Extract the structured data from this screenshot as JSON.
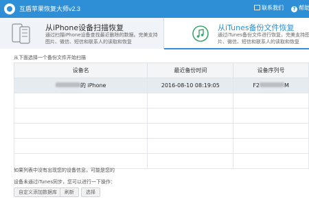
{
  "app": {
    "title": "互盾苹果恢复大师v2.3",
    "contact": "联系我们",
    "help": "帮助"
  },
  "modes": [
    {
      "title": "从iPhone设备扫描恢复",
      "desc": "通过扫描iPhone设备查找最近删除的数据。完美支持图片、微信、短信和联系人的读取和恢复"
    },
    {
      "title": "从iTunes备份文件恢复",
      "desc": "通过iTunes备份文件进行恢复，完美支持图片、微信、短信和联系人的读取和恢复"
    }
  ],
  "hint_top": "从下面选择一个备份文件开始扫描",
  "table": {
    "headers": [
      "设备名",
      "最近备份时间",
      "设备序列号"
    ],
    "rows": [
      {
        "device": "的 iPhone",
        "time": "2016-08-10  08:19:05",
        "serial_prefix": "F2",
        "serial_suffix": "M"
      }
    ]
  },
  "notes": {
    "line1": "如果列表中没有出现您的设备信息，可能是您的",
    "line2": "设备未通过iTunes同步，您可以进行一下操作："
  },
  "buttons": {
    "custom": "自定义添加数据库",
    "refresh": "刷新",
    "select": "选择"
  },
  "colors": {
    "accent": "#2e8fd6",
    "selected_row": "#e6ebf0"
  },
  "icons": {
    "app": "app-logo-icon",
    "phone": "phone-icon",
    "music": "music-note-icon",
    "contact": "mail-icon",
    "help": "help-icon"
  }
}
